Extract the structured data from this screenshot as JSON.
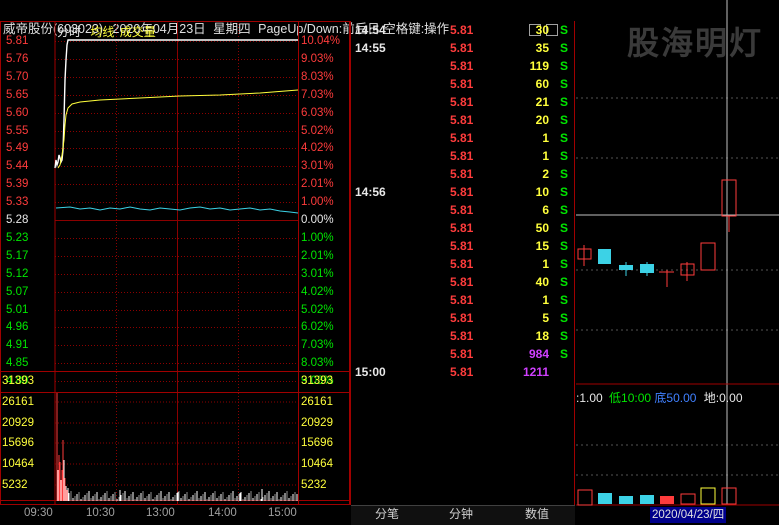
{
  "header": {
    "stock": "威帝股份(603023)",
    "date": "2020年04月23日",
    "weekday": "星期四",
    "hint": "PageUp/Down:前后日 空格键:操作",
    "tab_time": "分时",
    "tab_avg": "均线",
    "tab_vol": "成交量"
  },
  "price_axis_left": [
    "5.81",
    "5.76",
    "5.70",
    "5.65",
    "5.60",
    "5.55",
    "5.49",
    "5.44",
    "5.39",
    "5.33",
    "5.28",
    "5.23",
    "5.17",
    "5.12",
    "5.07",
    "5.01",
    "4.96",
    "4.91",
    "4.85",
    "4.80"
  ],
  "pct_axis_right": [
    "10.04%",
    "9.03%",
    "8.03%",
    "7.03%",
    "6.03%",
    "5.02%",
    "4.02%",
    "3.01%",
    "2.01%",
    "1.00%",
    "0.00%",
    "1.00%",
    "2.01%",
    "3.01%",
    "4.02%",
    "5.02%",
    "6.02%",
    "7.03%",
    "8.03%",
    "9.03%"
  ],
  "volume_axis": [
    "31393",
    "26161",
    "20929",
    "15696",
    "10464",
    "5232"
  ],
  "time_axis": [
    "09:30",
    "10:30",
    "13:00",
    "14:00",
    "15:00"
  ],
  "ticks": [
    {
      "time": "14:54",
      "price": "5.81",
      "vol": "30",
      "side": "S"
    },
    {
      "time": "14:55",
      "price": "5.81",
      "vol": "35",
      "side": "S"
    },
    {
      "time": "",
      "price": "5.81",
      "vol": "119",
      "side": "S"
    },
    {
      "time": "",
      "price": "5.81",
      "vol": "60",
      "side": "S"
    },
    {
      "time": "",
      "price": "5.81",
      "vol": "21",
      "side": "S"
    },
    {
      "time": "",
      "price": "5.81",
      "vol": "20",
      "side": "S"
    },
    {
      "time": "",
      "price": "5.81",
      "vol": "1",
      "side": "S"
    },
    {
      "time": "",
      "price": "5.81",
      "vol": "1",
      "side": "S"
    },
    {
      "time": "",
      "price": "5.81",
      "vol": "2",
      "side": "S"
    },
    {
      "time": "14:56",
      "price": "5.81",
      "vol": "10",
      "side": "S"
    },
    {
      "time": "",
      "price": "5.81",
      "vol": "6",
      "side": "S"
    },
    {
      "time": "",
      "price": "5.81",
      "vol": "50",
      "side": "S"
    },
    {
      "time": "",
      "price": "5.81",
      "vol": "15",
      "side": "S"
    },
    {
      "time": "",
      "price": "5.81",
      "vol": "1",
      "side": "S"
    },
    {
      "time": "",
      "price": "5.81",
      "vol": "40",
      "side": "S"
    },
    {
      "time": "",
      "price": "5.81",
      "vol": "1",
      "side": "S"
    },
    {
      "time": "",
      "price": "5.81",
      "vol": "5",
      "side": "S"
    },
    {
      "time": "",
      "price": "5.81",
      "vol": "18",
      "side": "S"
    },
    {
      "time": "",
      "price": "5.81",
      "vol": "984",
      "side": "S"
    },
    {
      "time": "15:00",
      "price": "5.81",
      "vol": "1211",
      "side": ""
    }
  ],
  "tabs": [
    "分笔",
    "分钟",
    "数值"
  ],
  "watermark": "股海明灯",
  "right_panel": {
    "indicator_prefix": ":1.00",
    "low_label": "低10:00",
    "bottom_label": "底50.00",
    "ground_label": "地:0.00",
    "date_label": "2020/04/23/四"
  },
  "colors": {
    "up": "#ff3c3c",
    "down": "#00e600",
    "avg": "#ffff3c",
    "price": "#ffffff",
    "volume": "#ffff3c",
    "grid": "#8b0000"
  }
}
